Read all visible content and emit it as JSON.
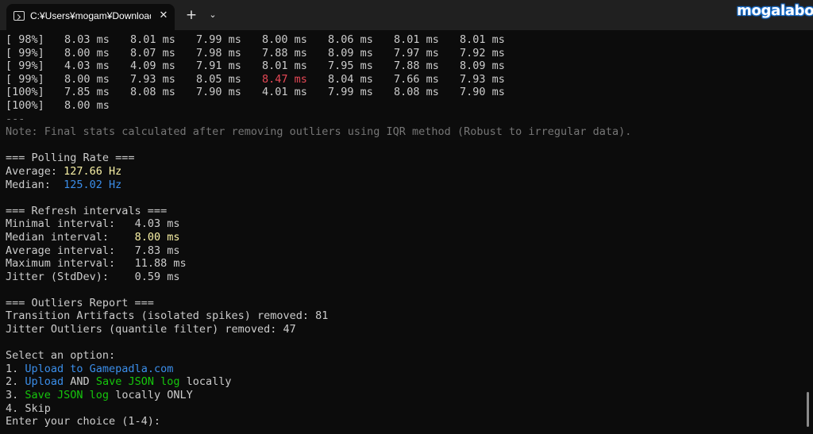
{
  "window": {
    "tab_title": "C:¥Users¥mogam¥Downloads",
    "close_glyph": "✕",
    "new_tab_glyph": "+",
    "dropdown_glyph": "⌄",
    "watermark": "mogalabo"
  },
  "terminal": {
    "rows": [
      {
        "pct": "[ 98%]",
        "vals": [
          "8.03 ms",
          "8.01 ms",
          "7.99 ms",
          "8.00 ms",
          "8.06 ms",
          "8.01 ms",
          "8.01 ms"
        ]
      },
      {
        "pct": "[ 99%]",
        "vals": [
          "8.00 ms",
          "8.07 ms",
          "7.98 ms",
          "7.88 ms",
          "8.09 ms",
          "7.97 ms",
          "7.92 ms"
        ]
      },
      {
        "pct": "[ 99%]",
        "vals": [
          "4.03 ms",
          "4.09 ms",
          "7.91 ms",
          "8.01 ms",
          "7.95 ms",
          "7.88 ms",
          "8.09 ms"
        ]
      },
      {
        "pct": "[ 99%]",
        "vals": [
          "8.00 ms",
          "7.93 ms",
          "8.05 ms",
          "8.47 ms",
          "8.04 ms",
          "7.66 ms",
          "7.93 ms"
        ]
      },
      {
        "pct": "[100%]",
        "vals": [
          "7.85 ms",
          "8.08 ms",
          "7.90 ms",
          "4.01 ms",
          "7.99 ms",
          "8.08 ms",
          "7.90 ms"
        ]
      },
      {
        "pct": "[100%]",
        "vals": [
          "8.00 ms"
        ]
      }
    ],
    "separator": "---",
    "note": "Note: Final stats calculated after removing outliers using IQR method (Robust to irregular data).",
    "polling": {
      "header": "=== Polling Rate ===",
      "average_label": "Average: ",
      "average_value": "127.66 Hz",
      "median_label": "Median:  ",
      "median_value": "125.02 Hz"
    },
    "intervals": {
      "header": "=== Refresh intervals ===",
      "minimal_label": "Minimal interval:   ",
      "minimal_value": "4.03 ms",
      "median_label": "Median interval:    ",
      "median_value": "8.00 ms",
      "average_label": "Average interval:   ",
      "average_value": "7.83 ms",
      "maximum_label": "Maximum interval:   ",
      "maximum_value": "11.88 ms",
      "jitter_label": "Jitter (StdDev):    ",
      "jitter_value": "0.59 ms"
    },
    "outliers": {
      "header": "=== Outliers Report ===",
      "transition": "Transition Artifacts (isolated spikes) removed: 81",
      "jitter": "Jitter Outliers (quantile filter) removed: 47"
    },
    "menu": {
      "prompt": "Select an option:",
      "o1_num": "1. ",
      "o1_text": "Upload to Gamepadla.com",
      "o2_num": "2. ",
      "o2_upload": "Upload",
      "o2_and": " AND ",
      "o2_save": "Save JSON log",
      "o2_rest": " locally",
      "o3_num": "3. ",
      "o3_save": "Save JSON log",
      "o3_rest": " locally ONLY",
      "o4": "4. Skip",
      "input_prompt": "Enter your choice (1-4): "
    }
  },
  "colors": {
    "background": "#0c0c0c",
    "text": "#cccccc",
    "gray": "#767676",
    "yellow": "#f9f1a5",
    "blue": "#3b8eea",
    "red": "#e74856",
    "green": "#16c60c"
  }
}
